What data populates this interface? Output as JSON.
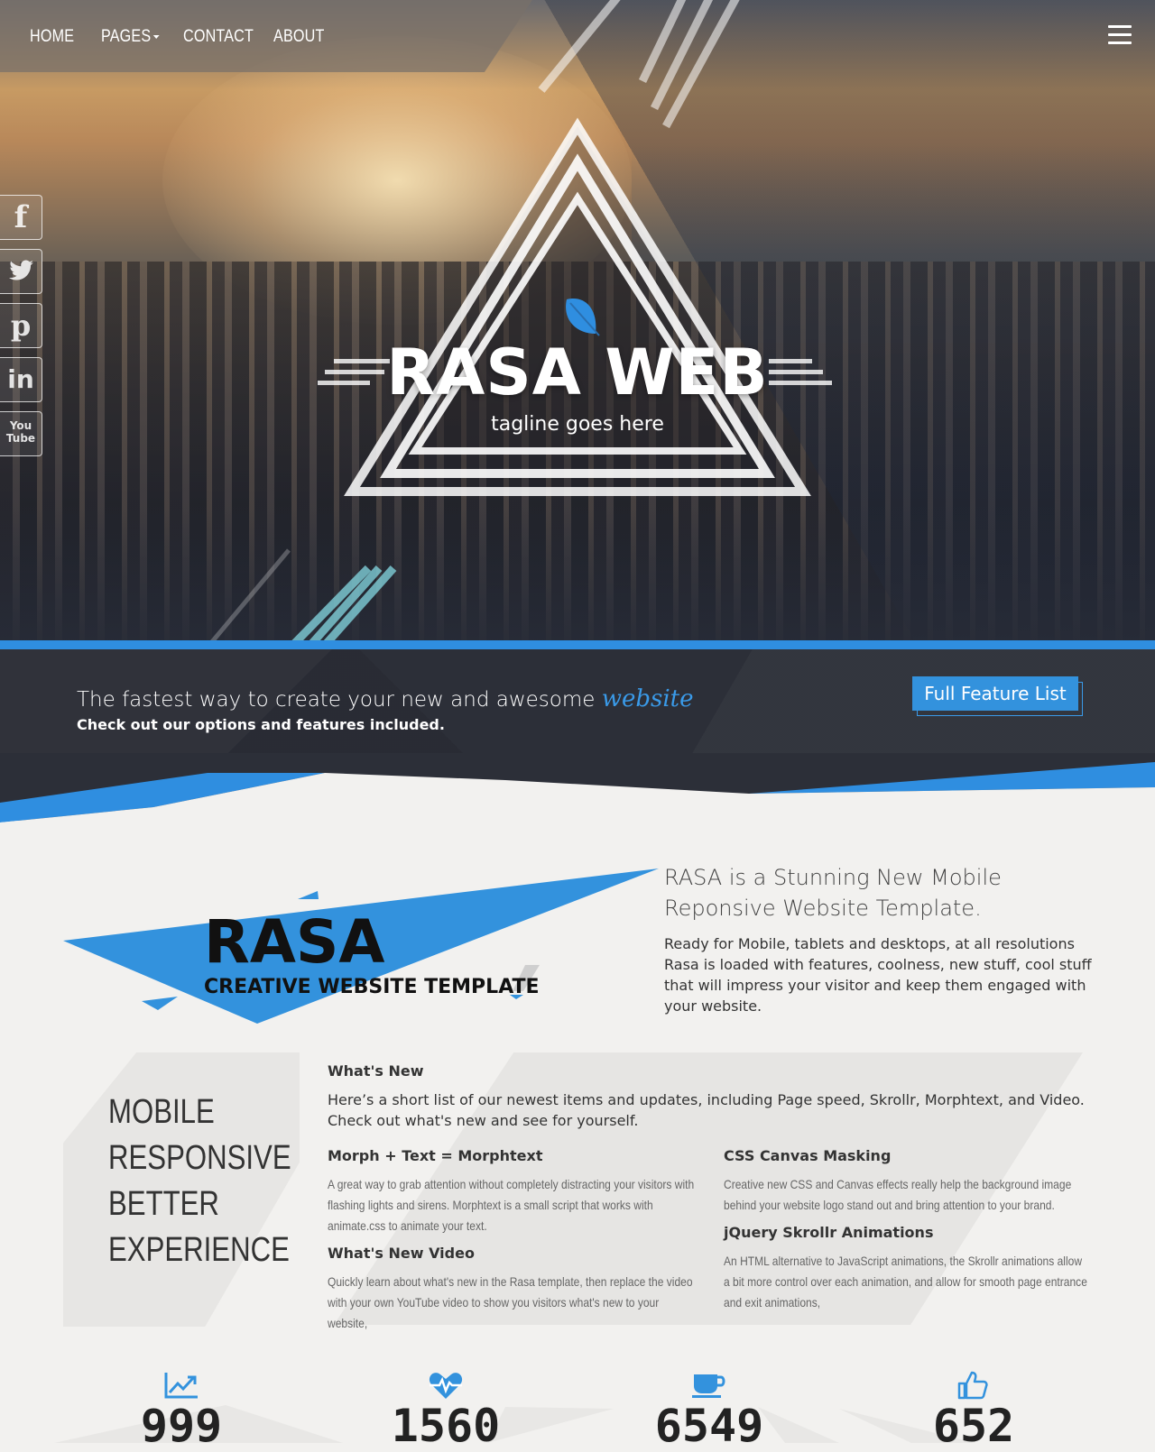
{
  "nav": {
    "items": [
      {
        "label": "HOME"
      },
      {
        "label": "PAGES"
      },
      {
        "label": "CONTACT"
      },
      {
        "label": "ABOUT"
      }
    ],
    "menu_icon": "hamburger-icon"
  },
  "social": [
    {
      "icon": "facebook-icon",
      "glyph": "f"
    },
    {
      "icon": "twitter-icon",
      "glyph": ""
    },
    {
      "icon": "pinterest-icon",
      "glyph": "p"
    },
    {
      "icon": "linkedin-icon",
      "glyph": "in"
    },
    {
      "icon": "youtube-icon",
      "glyph": "You Tube"
    }
  ],
  "hero": {
    "title": "RASA WEB",
    "tagline": "tagline goes here",
    "logo_icon": "leaf-icon"
  },
  "cta": {
    "line1": "The fastest way to create your new and awesome",
    "accent": "website",
    "line2": "Check out our options and features included.",
    "button": "Full Feature List"
  },
  "intro": {
    "logo_big": "RASA",
    "logo_sub": "CREATIVE WEBSITE TEMPLATE",
    "heading": "RASA is a Stunning New Mobile Reponsive Website Template.",
    "body": "Ready for Mobile, tablets and desktops, at all resolutions Rasa is loaded with features, coolness, new stuff, cool stuff that will impress your visitor and keep them engaged with your website."
  },
  "features": {
    "headline": [
      "MOBILE",
      "RESPONSIVE",
      "BETTER",
      "EXPERIENCE"
    ],
    "whats_new_title": "What's New",
    "whats_new_body": "Here’s a short list of our newest items and updates, including Page speed, Skrollr, Morphtext, and Video. Check out what's new and see for yourself.",
    "items": [
      {
        "title": "Morph + Text = Morphtext",
        "body": "A great way to grab attention without completely distracting your visitors with flashing lights and sirens. Morphtext is a small script that works with animate.css to animate your text."
      },
      {
        "title": "CSS Canvas Masking",
        "body": "Creative new CSS and Canvas effects really help the background image behind your website logo stand out and bring attention to your brand."
      },
      {
        "title": "What's New Video",
        "body": "Quickly learn about what's new in the Rasa template, then replace the video with your own YouTube video to show you visitors what's new to your website,"
      },
      {
        "title": "jQuery Skrollr Animations",
        "body": "An HTML alternative to JavaScript animations, the Skrollr animations allow a bit more control over each animation, and allow for smooth page entrance and exit animations,"
      }
    ]
  },
  "stats": [
    {
      "icon": "chart-line-icon",
      "value": "999"
    },
    {
      "icon": "heartbeat-icon",
      "value": "1560"
    },
    {
      "icon": "coffee-cup-icon",
      "value": "6549"
    },
    {
      "icon": "thumbs-up-icon",
      "value": "652"
    }
  ],
  "colors": {
    "accent": "#3392dd",
    "dark_band": "#2c2f38",
    "page_bg": "#f2f1ef"
  }
}
